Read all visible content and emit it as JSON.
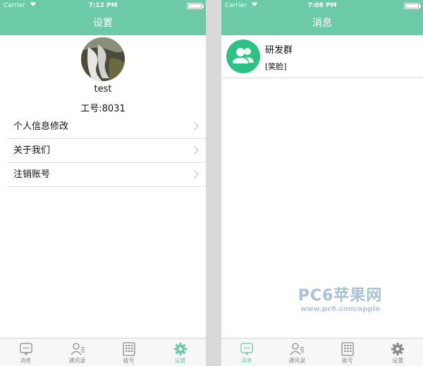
{
  "left_screen": {
    "status": {
      "carrier": "Carrier",
      "time": "7:12 PM"
    },
    "title": "设置",
    "profile": {
      "name": "test",
      "employee_id": "工号:8031"
    },
    "menu": [
      {
        "label": "个人信息修改"
      },
      {
        "label": "关于我们"
      },
      {
        "label": "注销账号"
      }
    ],
    "active_tab": "设置"
  },
  "right_screen": {
    "status": {
      "carrier": "Carrier",
      "time": "7:08 PM"
    },
    "title": "消息",
    "chats": [
      {
        "name": "研发群",
        "preview": "[笑脸]",
        "icon": "group-icon"
      }
    ],
    "active_tab": "消息"
  },
  "tabs": [
    {
      "label": "消息",
      "icon": "chat-bubble-icon"
    },
    {
      "label": "通讯录",
      "icon": "contacts-icon"
    },
    {
      "label": "拨号",
      "icon": "dialpad-icon"
    },
    {
      "label": "设置",
      "icon": "gear-icon"
    }
  ],
  "watermark": {
    "logo": "PC6苹果网",
    "url": "www.pc6.com/apple"
  },
  "colors": {
    "header": "#6ccaa6",
    "tab_active": "#6ccaa6",
    "group_avatar": "#2dc183"
  }
}
